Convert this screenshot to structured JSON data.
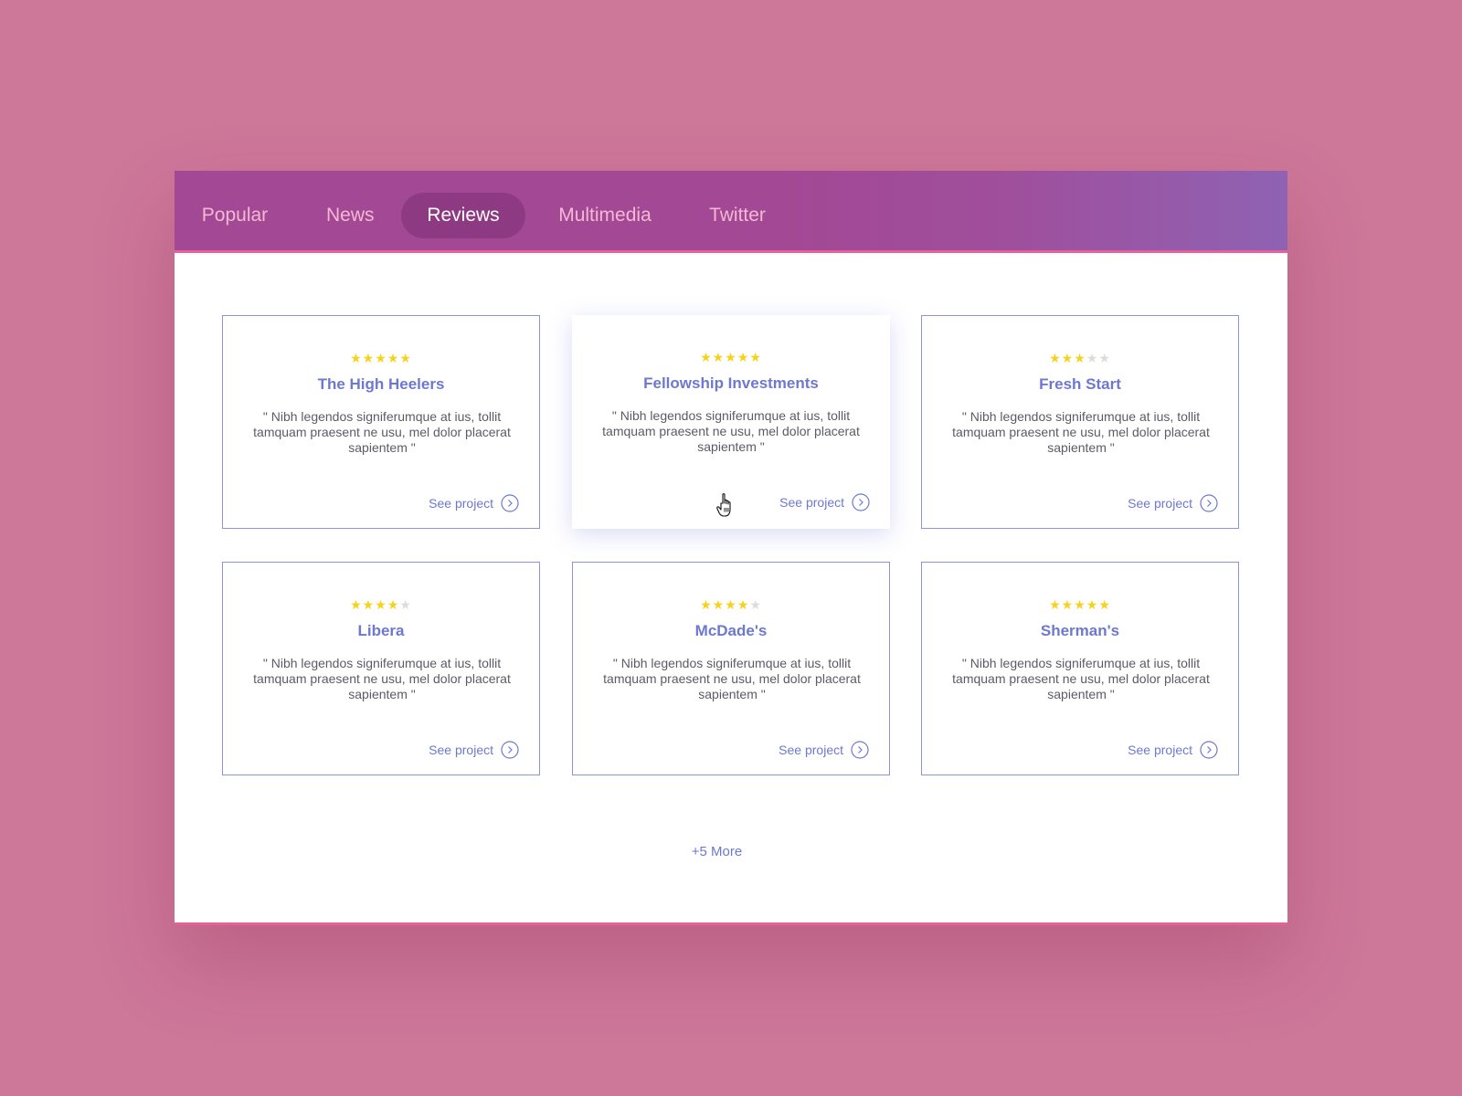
{
  "nav": {
    "tabs": [
      {
        "label": "Popular",
        "active": false
      },
      {
        "label": "News",
        "active": false
      },
      {
        "label": "Reviews",
        "active": true
      },
      {
        "label": "Multimedia",
        "active": false
      },
      {
        "label": "Twitter",
        "active": false
      }
    ]
  },
  "cards": [
    {
      "rating": 5,
      "max_rating": 5,
      "title": "The High Heelers",
      "quote": "\" Nibh legendos signiferumque at ius, tollit tamquam praesent ne usu, mel dolor placerat sapientem \"",
      "link_label": "See project"
    },
    {
      "rating": 5,
      "max_rating": 5,
      "title": "Fellowship Investments",
      "quote": "\" Nibh legendos signiferumque at ius, tollit tamquam praesent ne usu, mel dolor placerat sapientem \"",
      "link_label": "See project",
      "hovered": true
    },
    {
      "rating": 3,
      "max_rating": 5,
      "title": "Fresh Start",
      "quote": "\" Nibh legendos signiferumque at ius, tollit tamquam praesent ne usu, mel dolor placerat sapientem \"",
      "link_label": "See project"
    },
    {
      "rating": 4,
      "max_rating": 5,
      "title": "Libera",
      "quote": "\" Nibh legendos signiferumque at ius, tollit tamquam praesent ne usu, mel dolor placerat sapientem \"",
      "link_label": "See project"
    },
    {
      "rating": 4,
      "max_rating": 5,
      "title": "McDade's",
      "quote": "\" Nibh legendos signiferumque at ius, tollit tamquam praesent ne usu, mel dolor placerat sapientem \"",
      "link_label": "See project"
    },
    {
      "rating": 5,
      "max_rating": 5,
      "title": "Sherman's",
      "quote": "\" Nibh legendos signiferumque at ius, tollit tamquam praesent ne usu, mel dolor placerat sapientem \"",
      "link_label": "See project"
    }
  ],
  "more": {
    "label": "+5 More"
  },
  "icons": {
    "link_arrow": "chevron-right-circle-icon",
    "star": "star-icon",
    "cursor": "hand-pointer-cursor-icon"
  },
  "colors": {
    "background": "#cd7799",
    "nav_gradient_start": "#a24894",
    "nav_gradient_end": "#8f62b3",
    "active_tab": "#8d3a82",
    "accent_line": "#e8609a",
    "title_text": "#6d78cf",
    "star_on": "#f6d21a",
    "star_off": "#dcdcdc",
    "card_border": "#8c95d8"
  }
}
